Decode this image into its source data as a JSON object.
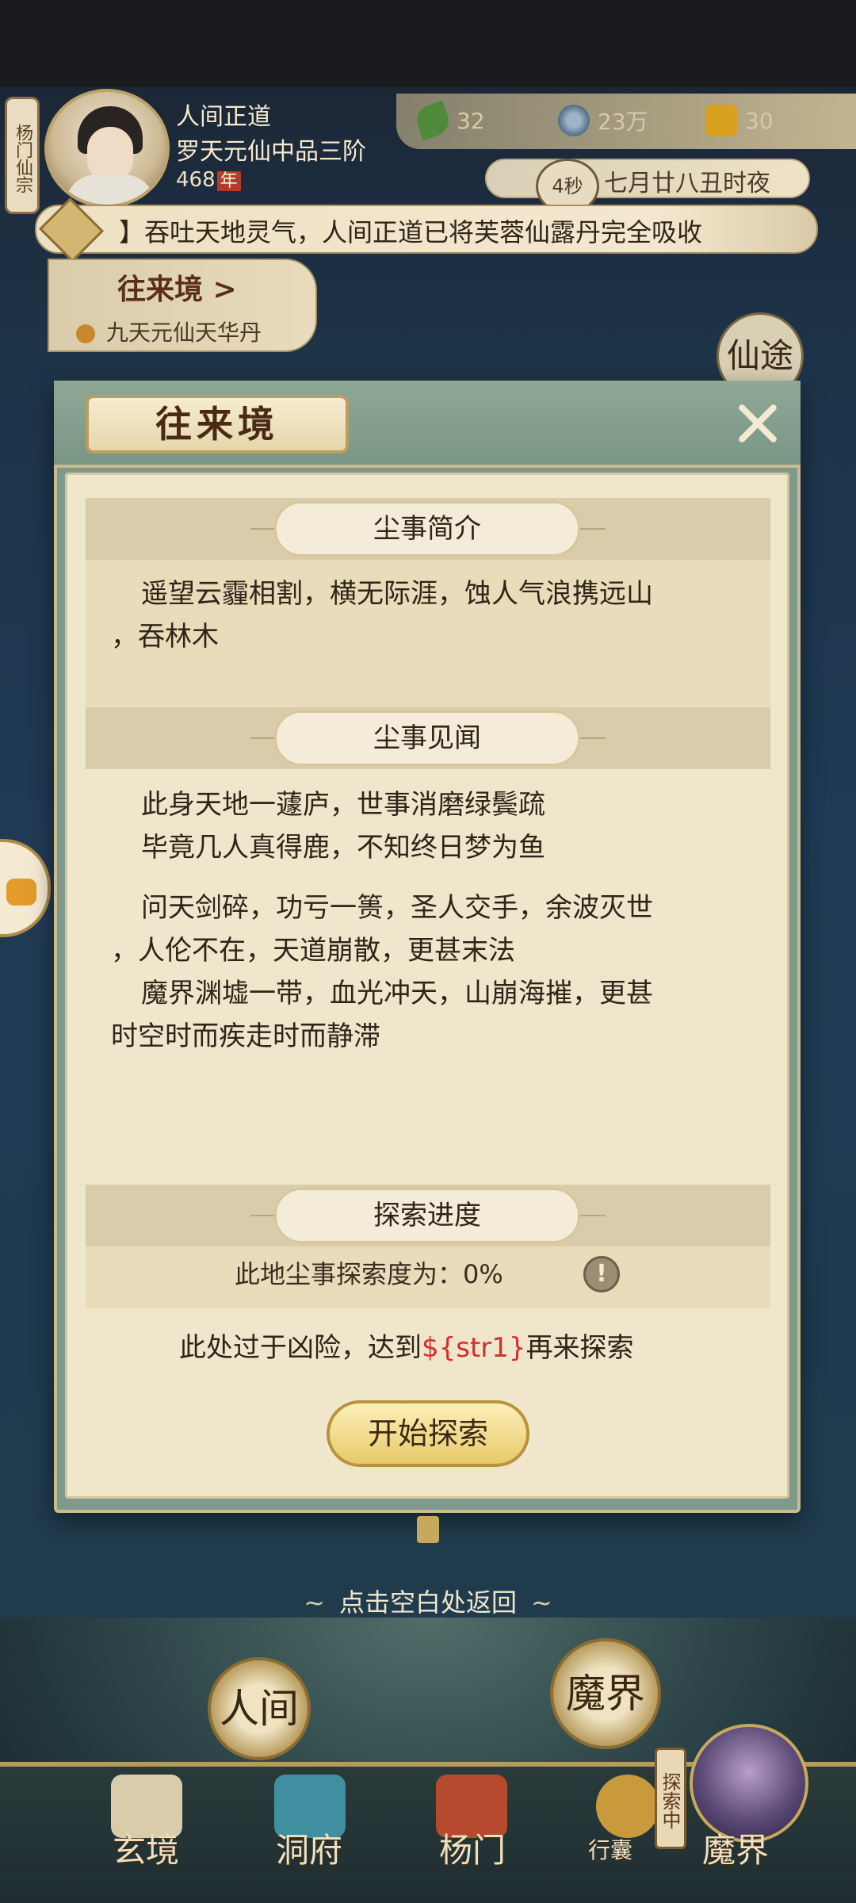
{
  "header": {
    "sect_label": "杨门仙宗",
    "player_name": "人间正道",
    "player_rank": "罗天元仙中品三阶",
    "player_age": "468",
    "age_unit": "年",
    "resources": [
      {
        "icon": "leaf-icon",
        "value": "32"
      },
      {
        "icon": "coin-icon",
        "value": "23万"
      },
      {
        "icon": "pill-icon",
        "value": "30"
      }
    ],
    "timer": "4秒",
    "time_text": "七月廿八丑时夜",
    "ticker_text": "】吞吐天地灵气，人间正道已将芙蓉仙露丹完全吸收",
    "sub_panel": {
      "title": "往来境 >",
      "item": "九天元仙天华丹"
    },
    "side_badge": "仙途"
  },
  "dialog": {
    "title": "往来境",
    "sections": {
      "intro": {
        "heading": "尘事简介",
        "lines": [
          "遥望云霾相割，横无际涯，蚀人气浪携远山",
          "，吞林木"
        ]
      },
      "lore": {
        "heading": "尘事见闻",
        "lines": [
          "此身天地一蘧庐，世事消磨绿鬓疏",
          "毕竟几人真得鹿，不知终日梦为鱼",
          "问天剑碎，功亏一篑，圣人交手，余波灭世",
          "，人伦不在，天道崩散，更甚末法",
          "魔界渊墟一带，血光冲天，山崩海摧，更甚",
          "时空时而疾走时而静滞"
        ]
      },
      "progress": {
        "heading": "探索进度",
        "label": "此地尘事探索度为：0%",
        "info_icon": "!"
      }
    },
    "danger_prefix": "此处过于凶险，达到",
    "danger_var": "${str1}",
    "danger_suffix": "再来探索",
    "start_button": "开始探索"
  },
  "hint": "点击空白处返回",
  "realms": {
    "left": "人间",
    "right": "魔界"
  },
  "nav": {
    "items": [
      "玄境",
      "洞府",
      "杨门",
      "行囊",
      "魔界"
    ],
    "explore_tag": "探索中"
  }
}
